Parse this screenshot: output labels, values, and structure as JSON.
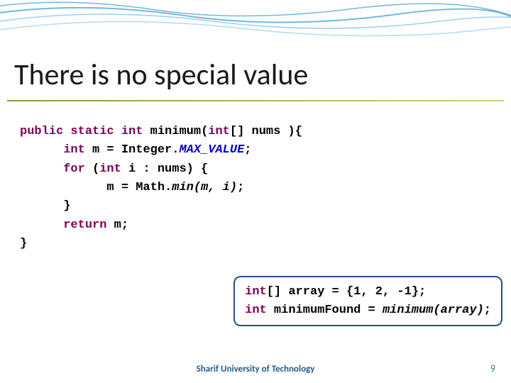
{
  "title": "There is no special value",
  "code": {
    "l1a": "public",
    "l1b": "static",
    "l1c": "int",
    "l1d": " minimum(",
    "l1e": "int",
    "l1f": "[] nums ){",
    "l2a": "int",
    "l2b": " m = Integer.",
    "l2c": "MAX_VALUE",
    "l2d": ";",
    "l3a": "for",
    "l3b": " (",
    "l3c": "int",
    "l3d": " i : nums) {",
    "l4a": "m = Math.",
    "l4b": "min(m, i)",
    "l4c": ";",
    "l5": "}",
    "l6a": "return",
    "l6b": " m;",
    "l7": "}"
  },
  "callout": {
    "l1a": "int",
    "l1b": "[] array = {1, 2, -1};",
    "l2a": "int",
    "l2b": " minimumFound = ",
    "l2c": "minimum(array)",
    "l2d": ";"
  },
  "footer": "Sharif University of Technology",
  "page_number": "9",
  "colors": {
    "keyword": "#7f0055",
    "accent_border": "#2a4e8a",
    "underline_green": "#8a9b3e"
  }
}
